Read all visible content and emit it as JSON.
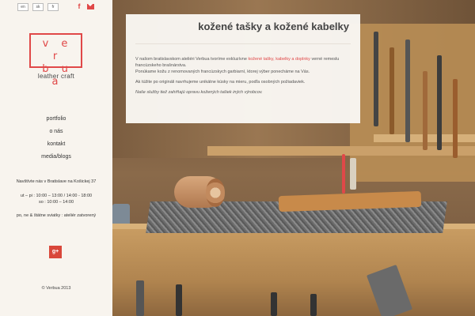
{
  "language_switch": [
    "en",
    "sk",
    "fr"
  ],
  "social_top": {
    "facebook_icon": "facebook-icon",
    "mail_icon": "mail-icon"
  },
  "logo": {
    "line1": "v e r",
    "line2": "b u a"
  },
  "tagline": "leather craft",
  "nav": [
    "portfolio",
    "o nás",
    "kontakt",
    "media/blogs"
  ],
  "info": {
    "address": "Navštívte nás v Bratislave na Košickej 37",
    "hours_line1": "ut – pi : 10:00 – 13:00 / 14:00 - 18:00",
    "hours_line2": "so : 10:00 – 14:00",
    "closed": "po, ne & štátne sviatky : ateliér zatvorený"
  },
  "gplus_label": "g+",
  "copyright": "© Verbua 2013",
  "panel": {
    "title": "kožené tašky a kožené kabelky",
    "p1_start": "V našom bratislavskom ateliéri Verbua tvoríme exkluzívne",
    "p1_link": "kožené tašky, kabelky a doplnky",
    "p1_end": "verné remeslu francúzskeho brašnárstva.",
    "p1_line2": "Ponúkame kožu z renomovaných francúzskych garbiarní, ktorej výber ponecháme na Vás.",
    "p2": "Ak túžite po origináli navrhujeme unikátne kúsky na mieru, podľa osobných požiadaviek.",
    "p3": "Naše služby tiež zahŕňajú opravu kožených tašiek iných výrobcov."
  },
  "colors": {
    "accent": "#e04848",
    "sidebar_bg": "#f8f4ee",
    "gplus": "#d9473a"
  }
}
